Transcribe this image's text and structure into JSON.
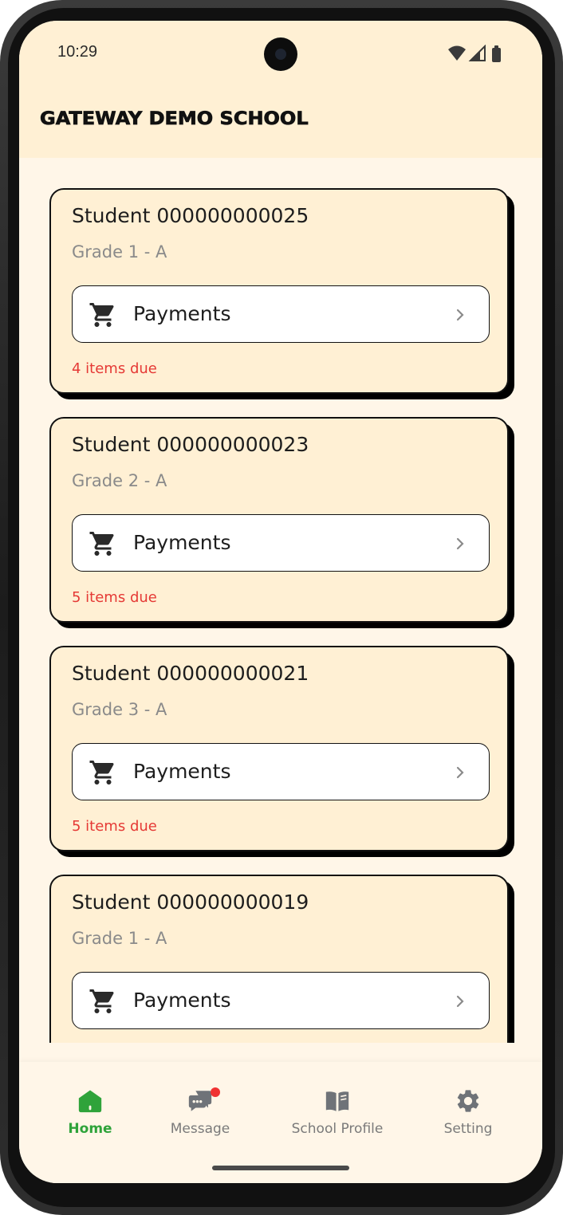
{
  "status_bar": {
    "time": "10:29"
  },
  "header": {
    "title": "GATEWAY DEMO SCHOOL"
  },
  "students": [
    {
      "name": "Student 000000000025",
      "grade": "Grade 1 - A",
      "button_label": "Payments",
      "due_text": "4 items due"
    },
    {
      "name": "Student 000000000023",
      "grade": "Grade 2 - A",
      "button_label": "Payments",
      "due_text": "5 items due"
    },
    {
      "name": "Student 000000000021",
      "grade": "Grade 3 - A",
      "button_label": "Payments",
      "due_text": "5 items due"
    },
    {
      "name": "Student 000000000019",
      "grade": "Grade 1 - A",
      "button_label": "Payments",
      "due_text": ""
    }
  ],
  "nav": {
    "items": [
      {
        "label": "Home",
        "icon": "home-icon",
        "active": true
      },
      {
        "label": "Message",
        "icon": "chat-icon",
        "active": false,
        "badge": true
      },
      {
        "label": "School Profile",
        "icon": "book-icon",
        "active": false
      },
      {
        "label": "Setting",
        "icon": "gear-icon",
        "active": false
      }
    ]
  },
  "colors": {
    "header_bg": "#FFF0D4",
    "page_bg": "#FFF6E8",
    "card_bg": "#FFF0D4",
    "due_text": "#E53935",
    "nav_active": "#2FA33A",
    "nav_inactive": "#7a7a7a",
    "badge": "#F03232"
  }
}
